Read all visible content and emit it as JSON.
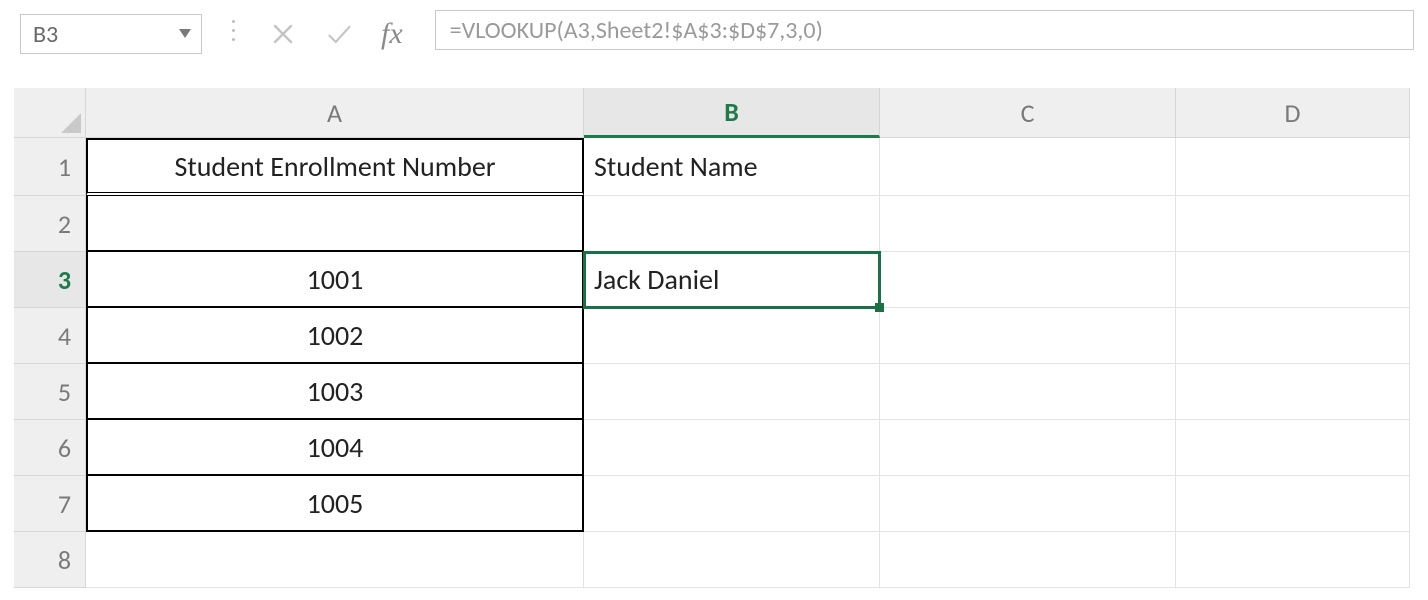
{
  "name_box": {
    "ref": "B3"
  },
  "formula_bar": {
    "value": "=VLOOKUP(A3,Sheet2!$A$3:$D$7,3,0)"
  },
  "icons": {
    "cancel": "cancel-icon",
    "enter": "enter-icon",
    "fx": "fx",
    "chevron_down": "chevron-down-icon"
  },
  "columns": [
    "A",
    "B",
    "C",
    "D"
  ],
  "active_column": "B",
  "row_headers": [
    "1",
    "2",
    "3",
    "4",
    "5",
    "6",
    "7",
    "8"
  ],
  "active_row": "3",
  "selected_cell": "B3",
  "table": {
    "header": {
      "A": "Student Enrollment Number",
      "B": "Student Name"
    },
    "rows": [
      {
        "A": "1001",
        "B": "Jack Daniel"
      },
      {
        "A": "1002",
        "B": ""
      },
      {
        "A": "1003",
        "B": ""
      },
      {
        "A": "1004",
        "B": ""
      },
      {
        "A": "1005",
        "B": ""
      }
    ]
  }
}
